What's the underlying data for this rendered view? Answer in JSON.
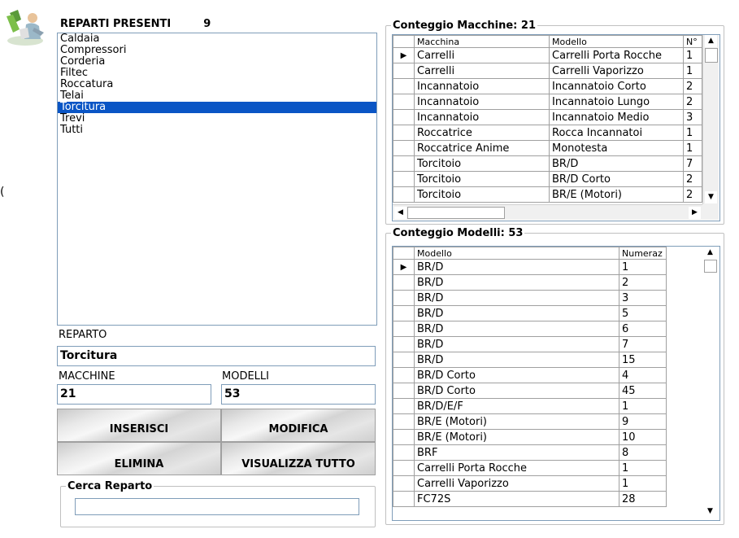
{
  "reparti": {
    "title": "REPARTI PRESENTI",
    "count": "9",
    "items": [
      "Caldaia",
      "Compressori",
      "Corderia",
      "Filtec",
      "Roccatura",
      "Telai",
      "Torcitura",
      "Trevi",
      "Tutti"
    ],
    "selected_index": 6
  },
  "form": {
    "reparto_label": "REPARTO",
    "reparto_value": "Torcitura",
    "macchine_label": "MACCHINE",
    "macchine_value": "21",
    "modelli_label": "MODELLI",
    "modelli_value": "53"
  },
  "buttons": {
    "inserisci": "INSERISCI",
    "modifica": "MODIFICA",
    "elimina": "ELIMINA",
    "visualizza": "VISUALIZZA TUTTO"
  },
  "search": {
    "legend": "Cerca Reparto",
    "value": ""
  },
  "macchine_grid": {
    "legend": "Conteggio Macchine: 21",
    "headers": [
      "Macchina",
      "Modello",
      "N°"
    ],
    "rows": [
      [
        "Carrelli",
        "Carrelli Porta Rocche",
        "1"
      ],
      [
        "Carrelli",
        "Carrelli Vaporizzo",
        "1"
      ],
      [
        "Incannatoio",
        "Incannatoio Corto",
        "2"
      ],
      [
        "Incannatoio",
        "Incannatoio Lungo",
        "2"
      ],
      [
        "Incannatoio",
        "Incannatoio Medio",
        "3"
      ],
      [
        "Roccatrice",
        "Rocca Incannatoi",
        "1"
      ],
      [
        "Roccatrice Anime",
        "Monotesta",
        "1"
      ],
      [
        "Torcitoio",
        "BR/D",
        "7"
      ],
      [
        "Torcitoio",
        "BR/D Corto",
        "2"
      ],
      [
        "Torcitoio",
        "BR/E (Motori)",
        "2"
      ]
    ]
  },
  "modelli_grid": {
    "legend": "Conteggio Modelli: 53",
    "headers": [
      "Modello",
      "Numeraz"
    ],
    "rows": [
      [
        "BR/D",
        "1"
      ],
      [
        "BR/D",
        "2"
      ],
      [
        "BR/D",
        "3"
      ],
      [
        "BR/D",
        "5"
      ],
      [
        "BR/D",
        "6"
      ],
      [
        "BR/D",
        "7"
      ],
      [
        "BR/D",
        "15"
      ],
      [
        "BR/D Corto",
        "4"
      ],
      [
        "BR/D Corto",
        "45"
      ],
      [
        "BR/D/E/F",
        "1"
      ],
      [
        "BR/E (Motori)",
        "9"
      ],
      [
        "BR/E (Motori)",
        "10"
      ],
      [
        "BRF",
        "8"
      ],
      [
        "Carrelli Porta Rocche",
        "1"
      ],
      [
        "Carrelli Vaporizzo",
        "1"
      ],
      [
        "FC72S",
        "28"
      ]
    ]
  },
  "icons": {
    "row_pointer": "▶",
    "scroll_up": "▲",
    "scroll_down": "▼",
    "scroll_left": "◀",
    "scroll_right": "▶",
    "side_glyph": "(",
    "logo": "worker-icon"
  },
  "colors": {
    "selection": "#0a55c5",
    "border": "#7f9db9"
  }
}
